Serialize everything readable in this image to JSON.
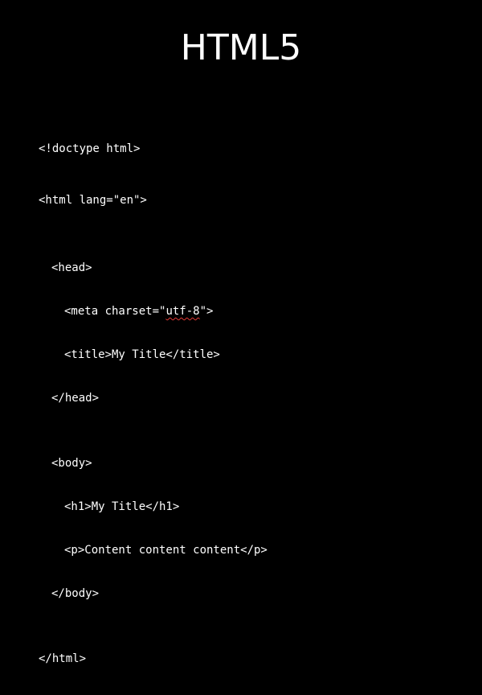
{
  "slide": {
    "title": "HTML5",
    "code": {
      "doctype": "<!doctype html>",
      "html_open": "<html lang=\"en\">",
      "head_open": "<head>",
      "meta_prefix": "<meta charset=\"",
      "meta_value": "utf-8",
      "meta_suffix": "\">",
      "title_tag": "<title>My Title</title>",
      "head_close": "</head>",
      "body_open": "<body>",
      "h1_tag": "<h1>My Title</h1>",
      "p_tag": "<p>Content content content</p>",
      "body_close": "</body>",
      "html_close": "</html>"
    },
    "colors": {
      "background": "#000000",
      "text": "#ffffff",
      "spellcheck_underline": "#e53935"
    }
  }
}
